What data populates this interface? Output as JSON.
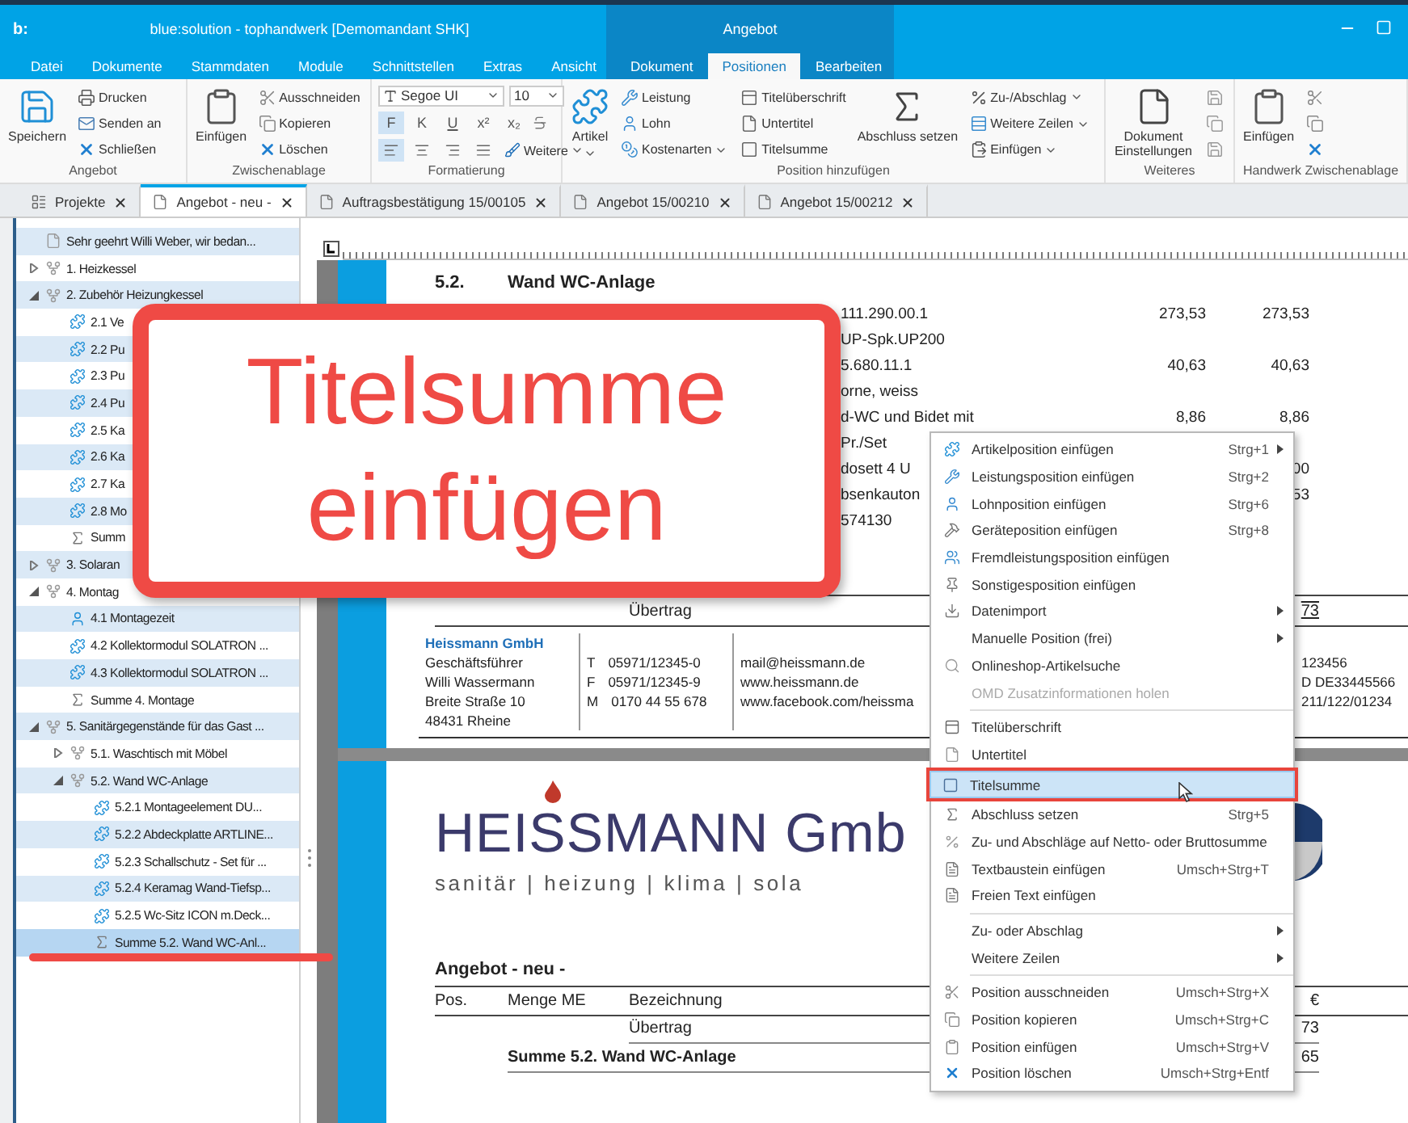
{
  "window": {
    "logo": "b:",
    "title": "blue:solution - tophandwerk [Demomandant SHK]"
  },
  "menu_tabs": [
    {
      "label": "Datei",
      "selected": false
    },
    {
      "label": "Dokumente",
      "selected": false
    },
    {
      "label": "Stammdaten",
      "selected": false
    },
    {
      "label": "Module",
      "selected": false
    },
    {
      "label": "Schnittstellen",
      "selected": false
    },
    {
      "label": "Extras",
      "selected": false
    },
    {
      "label": "Ansicht",
      "selected": false
    }
  ],
  "context_group": {
    "label": "Angebot",
    "tabs": [
      {
        "label": "Dokument",
        "selected": false
      },
      {
        "label": "Positionen",
        "selected": true
      },
      {
        "label": "Bearbeiten",
        "selected": false
      }
    ]
  },
  "ribbon": [
    {
      "label": "Angebot",
      "columns": [
        {
          "kind": "large",
          "label": "Speichern",
          "dropdown": false
        },
        {
          "kind": "small",
          "items": [
            {
              "label": "Drucken",
              "dropdown": false
            },
            {
              "label": "Senden an",
              "dropdown": false
            },
            {
              "label": "Schließen",
              "dropdown": false
            }
          ]
        }
      ]
    },
    {
      "label": "Zwischenablage",
      "columns": [
        {
          "kind": "large",
          "label": "Einfügen",
          "dropdown": false
        },
        {
          "kind": "small",
          "items": [
            {
              "label": "Ausschneiden",
              "dropdown": false
            },
            {
              "label": "Kopieren",
              "dropdown": false
            },
            {
              "label": "Löschen",
              "dropdown": false
            }
          ]
        }
      ]
    },
    {
      "label": "Formatierung",
      "columns": [
        {
          "kind": "format",
          "font": "Segoe UI",
          "size": "10",
          "styles": [
            {
              "label": "F",
              "kind": "plain",
              "selected": true
            },
            {
              "label": "K",
              "kind": "plain",
              "selected": false
            },
            {
              "label": "U",
              "kind": "underline",
              "selected": false
            },
            {
              "label": "x²",
              "kind": "plain",
              "selected": false
            },
            {
              "label": "x₂",
              "kind": "plain",
              "selected": false
            }
          ],
          "alignments": [
            {
              "selected": true
            },
            {
              "selected": false
            },
            {
              "selected": false
            },
            {
              "selected": false
            }
          ],
          "more": "Weitere"
        }
      ]
    },
    {
      "label": "Position hinzufügen",
      "columns": [
        {
          "kind": "large",
          "label": "Artikel",
          "dropdown": true
        },
        {
          "kind": "small",
          "items": [
            {
              "label": "Leistung",
              "dropdown": false
            },
            {
              "label": "Lohn",
              "dropdown": false
            },
            {
              "label": "Kostenarten",
              "dropdown": true
            }
          ]
        },
        {
          "kind": "small",
          "items": [
            {
              "label": "Titelüberschrift",
              "dropdown": false
            },
            {
              "label": "Untertitel",
              "dropdown": false
            },
            {
              "label": "Titelsumme",
              "dropdown": false
            }
          ]
        },
        {
          "kind": "large",
          "label": "Abschluss setzen",
          "dropdown": false
        },
        {
          "kind": "small",
          "items": [
            {
              "label": "Zu-/Abschlag",
              "dropdown": true
            },
            {
              "label": "Weitere Zeilen",
              "dropdown": true
            },
            {
              "label": "Einfügen",
              "dropdown": true
            }
          ]
        }
      ]
    },
    {
      "label": "Weiteres",
      "columns": [
        {
          "kind": "large",
          "label": "Dokument Einstellungen",
          "dropdown": false
        },
        {
          "kind": "icon_column"
        }
      ]
    },
    {
      "label": "Handwerk Zwischenablage",
      "columns": [
        {
          "kind": "large",
          "label": "Einfügen",
          "dropdown": false
        },
        {
          "kind": "icon_column"
        }
      ]
    }
  ],
  "doc_tabs": [
    {
      "label": "Projekte",
      "selected": false
    },
    {
      "label": "Angebot - neu -",
      "selected": true
    },
    {
      "label": "Auftragsbestätigung 15/00105",
      "selected": false
    },
    {
      "label": "Angebot 15/00210",
      "selected": false
    },
    {
      "label": "Angebot 15/00212",
      "selected": false
    }
  ],
  "tree": [
    {
      "label": "Sehr geehrt Willi Weber, wir bedan...",
      "kind": "text",
      "selected": false
    },
    {
      "label": "1. Heizkessel",
      "kind": "title",
      "selected": false,
      "expanded": false
    },
    {
      "label": "2. Zubehör Heizungkessel",
      "kind": "title",
      "selected": false,
      "expanded": true,
      "children": [
        {
          "label": "2.1 Ve",
          "kind": "article",
          "selected": false
        },
        {
          "label": "2.2 Pu",
          "kind": "article",
          "selected": false
        },
        {
          "label": "2.3 Pu",
          "kind": "article",
          "selected": false
        },
        {
          "label": "2.4 Pu",
          "kind": "article",
          "selected": false
        },
        {
          "label": "2.5 Ka",
          "kind": "article",
          "selected": false
        },
        {
          "label": "2.6 Ka",
          "kind": "article",
          "selected": false
        },
        {
          "label": "2.7 Ka",
          "kind": "article",
          "selected": false
        },
        {
          "label": "2.8 Mo",
          "kind": "article",
          "selected": false
        },
        {
          "label": "Summ",
          "kind": "sum",
          "selected": false
        }
      ]
    },
    {
      "label": "3. Solaran",
      "kind": "title",
      "selected": false,
      "expanded": false
    },
    {
      "label": "4. Montag",
      "kind": "title",
      "selected": false,
      "expanded": true,
      "children": [
        {
          "label": "4.1 Montagezeit",
          "kind": "labor",
          "selected": false
        },
        {
          "label": "4.2 Kollektormodul SOLATRON ...",
          "kind": "article",
          "selected": false
        },
        {
          "label": "4.3 Kollektormodul SOLATRON ...",
          "kind": "article",
          "selected": false
        },
        {
          "label": "Summe 4. Montage",
          "kind": "sum",
          "selected": false
        }
      ]
    },
    {
      "label": "5. Sanitärgegenstände für das Gast ...",
      "kind": "title",
      "selected": false,
      "expanded": true,
      "children": [
        {
          "label": "5.1. Waschtisch mit Möbel",
          "kind": "title",
          "selected": false,
          "expanded": false
        },
        {
          "label": "5.2. Wand WC-Anlage",
          "kind": "title",
          "selected": false,
          "expanded": true,
          "children": [
            {
              "label": "5.2.1 Montageelement DU...",
              "kind": "article",
              "selected": false
            },
            {
              "label": "5.2.2 Abdeckplatte ARTLINE...",
              "kind": "article",
              "selected": false
            },
            {
              "label": "5.2.3 Schallschutz - Set für ...",
              "kind": "article",
              "selected": false
            },
            {
              "label": "5.2.4 Keramag Wand-Tiefsp...",
              "kind": "article",
              "selected": false
            },
            {
              "label": "5.2.5 Wc-Sitz ICON m.Deck...",
              "kind": "article",
              "selected": false
            },
            {
              "label": "Summe 5.2. Wand WC-Anl...",
              "kind": "sum",
              "selected": true
            }
          ]
        }
      ]
    }
  ],
  "document": {
    "heading": {
      "number": "5.2.",
      "title": "Wand WC-Anlage"
    },
    "rows": [
      {
        "text": "111.290.00.1",
        "price": "273,53",
        "total": "273,53"
      },
      {
        "text": "UP-Spk.UP200"
      },
      {
        "text": "5.680.11.1",
        "price": "40,63",
        "total": "40,63"
      },
      {
        "text": "orne, weiss"
      },
      {
        "text": "d-WC und Bidet mit",
        "price": "8,86",
        "total": "8,86"
      },
      {
        "text": "Pr./Set"
      },
      {
        "text": "dosett 4 U",
        "total": "00"
      },
      {
        "text": "bsenkauton",
        "total": "53"
      },
      {
        "text": "574130"
      }
    ],
    "carry_over": {
      "text": "Übertrag",
      "total": "73"
    },
    "footer": {
      "company": "Heissmann GmbH",
      "lines": [
        "Geschäftsführer",
        "Willi Wassermann",
        "Breite Straße 10",
        "48431 Rheine"
      ],
      "phones": [
        {
          "prefix": "T",
          "number": "05971/12345-0"
        },
        {
          "prefix": "F",
          "number": "05971/12345-9"
        },
        {
          "prefix": "M",
          "number": "0170 44 55 678"
        }
      ],
      "web": [
        "mail@heissmann.de",
        "www.heissmann.de",
        "www.facebook.com/heissma"
      ],
      "tax": [
        "123456",
        "D DE33445566",
        "211/122/01234"
      ]
    },
    "letterhead": {
      "company": "HEISSMANN Gmb",
      "tagline": "sanitär | heizung | klima | sola"
    },
    "offer_title": "Angebot - neu -",
    "table": {
      "columns": [
        "Pos.",
        "Menge ME",
        "Bezeichnung",
        "€"
      ],
      "rows": [
        {
          "kind": "carry",
          "text": "Übertrag",
          "total": "73"
        },
        {
          "kind": "sum",
          "text": "Summe 5.2. Wand WC-Anlage",
          "total": "65"
        }
      ]
    }
  },
  "context_menu": [
    {
      "kind": "item",
      "label": "Artikelposition einfügen",
      "shortcut": "Strg+1",
      "submenu": true,
      "disabled": false,
      "selected": false,
      "outlined": false
    },
    {
      "kind": "item",
      "label": "Leistungsposition einfügen",
      "shortcut": "Strg+2",
      "submenu": false,
      "disabled": false,
      "selected": false,
      "outlined": false
    },
    {
      "kind": "item",
      "label": "Lohnposition einfügen",
      "shortcut": "Strg+6",
      "submenu": false,
      "disabled": false,
      "selected": false,
      "outlined": false
    },
    {
      "kind": "item",
      "label": "Geräteposition einfügen",
      "shortcut": "Strg+8",
      "submenu": false,
      "disabled": false,
      "selected": false,
      "outlined": false
    },
    {
      "kind": "item",
      "label": "Fremdleistungsposition einfügen",
      "submenu": false,
      "disabled": false,
      "selected": false,
      "outlined": false
    },
    {
      "kind": "item",
      "label": "Sonstigesposition einfügen",
      "submenu": false,
      "disabled": false,
      "selected": false,
      "outlined": false
    },
    {
      "kind": "item",
      "label": "Datenimport",
      "submenu": true,
      "disabled": false,
      "selected": false,
      "outlined": false
    },
    {
      "kind": "item",
      "label": "Manuelle Position (frei)",
      "submenu": true,
      "disabled": false,
      "selected": false,
      "outlined": false
    },
    {
      "kind": "item",
      "label": "Onlineshop-Artikelsuche",
      "submenu": false,
      "disabled": false,
      "selected": false,
      "outlined": false
    },
    {
      "kind": "item",
      "label": "OMD Zusatzinformationen holen",
      "submenu": false,
      "disabled": true,
      "selected": false,
      "outlined": false
    },
    {
      "kind": "separator"
    },
    {
      "kind": "item",
      "label": "Titelüberschrift",
      "submenu": false,
      "disabled": false,
      "selected": false,
      "outlined": false
    },
    {
      "kind": "item",
      "label": "Untertitel",
      "submenu": false,
      "disabled": false,
      "selected": false,
      "outlined": false
    },
    {
      "kind": "item",
      "label": "Titelsumme",
      "submenu": false,
      "disabled": false,
      "selected": true,
      "outlined": true
    },
    {
      "kind": "item",
      "label": "Abschluss setzen",
      "shortcut": "Strg+5",
      "submenu": false,
      "disabled": false,
      "selected": false,
      "outlined": false
    },
    {
      "kind": "item",
      "label": "Zu- und Abschläge auf Netto- oder Bruttosumme",
      "submenu": false,
      "disabled": false,
      "selected": false,
      "outlined": false
    },
    {
      "kind": "item",
      "label": "Textbaustein einfügen",
      "shortcut": "Umsch+Strg+T",
      "submenu": false,
      "disabled": false,
      "selected": false,
      "outlined": false
    },
    {
      "kind": "item",
      "label": "Freien Text einfügen",
      "submenu": false,
      "disabled": false,
      "selected": false,
      "outlined": false
    },
    {
      "kind": "separator"
    },
    {
      "kind": "item",
      "label": "Zu- oder Abschlag",
      "submenu": true,
      "disabled": false,
      "selected": false,
      "outlined": false
    },
    {
      "kind": "item",
      "label": "Weitere Zeilen",
      "submenu": true,
      "disabled": false,
      "selected": false,
      "outlined": false
    },
    {
      "kind": "separator"
    },
    {
      "kind": "item",
      "label": "Position ausschneiden",
      "shortcut": "Umsch+Strg+X",
      "submenu": false,
      "disabled": false,
      "selected": false,
      "outlined": false
    },
    {
      "kind": "item",
      "label": "Position kopieren",
      "shortcut": "Umsch+Strg+C",
      "submenu": false,
      "disabled": false,
      "selected": false,
      "outlined": false
    },
    {
      "kind": "item",
      "label": "Position einfügen",
      "shortcut": "Umsch+Strg+V",
      "submenu": false,
      "disabled": false,
      "selected": false,
      "outlined": false
    },
    {
      "kind": "item",
      "label": "Position löschen",
      "shortcut": "Umsch+Strg+Entf",
      "submenu": false,
      "disabled": false,
      "selected": false,
      "outlined": false
    }
  ],
  "callout": {
    "text": "Titelsumme einfügen"
  }
}
